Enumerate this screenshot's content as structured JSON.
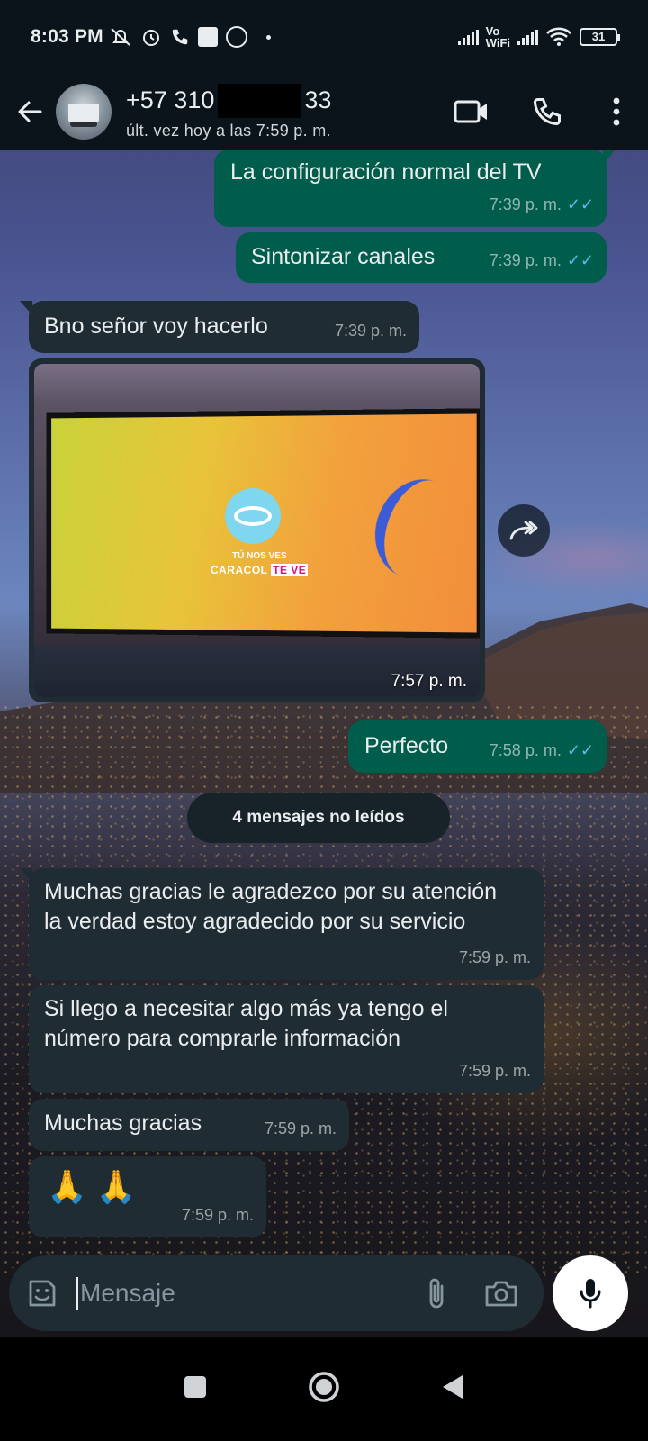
{
  "status_bar": {
    "time": "8:03 PM",
    "vowifi": "Vo\nWiFi",
    "battery": "31"
  },
  "header": {
    "phone_start": "+57 310",
    "phone_end": "33",
    "last_seen": "últ. vez hoy a las 7:59 p. m."
  },
  "messages": [
    {
      "direction": "out",
      "text": "La configuración normal del TV",
      "time": "7:39 p. m.",
      "ticks": "✓✓"
    },
    {
      "direction": "out",
      "text": "Sintonizar canales",
      "time": "7:39 p. m.",
      "ticks": "✓✓"
    },
    {
      "direction": "in",
      "text": "Bno señor voy hacerlo",
      "time": "7:39 p. m."
    },
    {
      "direction": "in",
      "type": "image",
      "time": "7:57 p. m.",
      "image_text_1": "TÚ NOS VES",
      "image_text_2": "CARACOL",
      "image_text_3": "TE VE"
    },
    {
      "direction": "out",
      "text": "Perfecto",
      "time": "7:58 p. m.",
      "ticks": "✓✓"
    },
    {
      "direction": "in",
      "text": "Muchas gracias le agradezco por su atención la verdad estoy agradecido por su servicio",
      "time": "7:59 p. m."
    },
    {
      "direction": "in",
      "text": "Si llego a necesitar algo más ya tengo el número para comprarle información",
      "time": "7:59 p. m."
    },
    {
      "direction": "in",
      "text": "Muchas gracias",
      "time": "7:59 p. m."
    },
    {
      "direction": "in",
      "text": "🙏 🙏",
      "time": "7:59 p. m."
    }
  ],
  "unread_divider": "4 mensajes no leídos",
  "composer": {
    "placeholder": "Mensaje"
  },
  "colors": {
    "outgoing_bubble": "#005c4b",
    "incoming_bubble": "#202c33",
    "header_bg": "#0b141a",
    "read_ticks": "#53bdeb"
  },
  "icons": [
    "back-arrow-icon",
    "video-call-icon",
    "phone-call-icon",
    "more-options-icon",
    "forward-icon",
    "sticker-icon",
    "attach-icon",
    "camera-icon",
    "mic-icon",
    "recents-icon",
    "home-icon",
    "back-nav-icon"
  ]
}
